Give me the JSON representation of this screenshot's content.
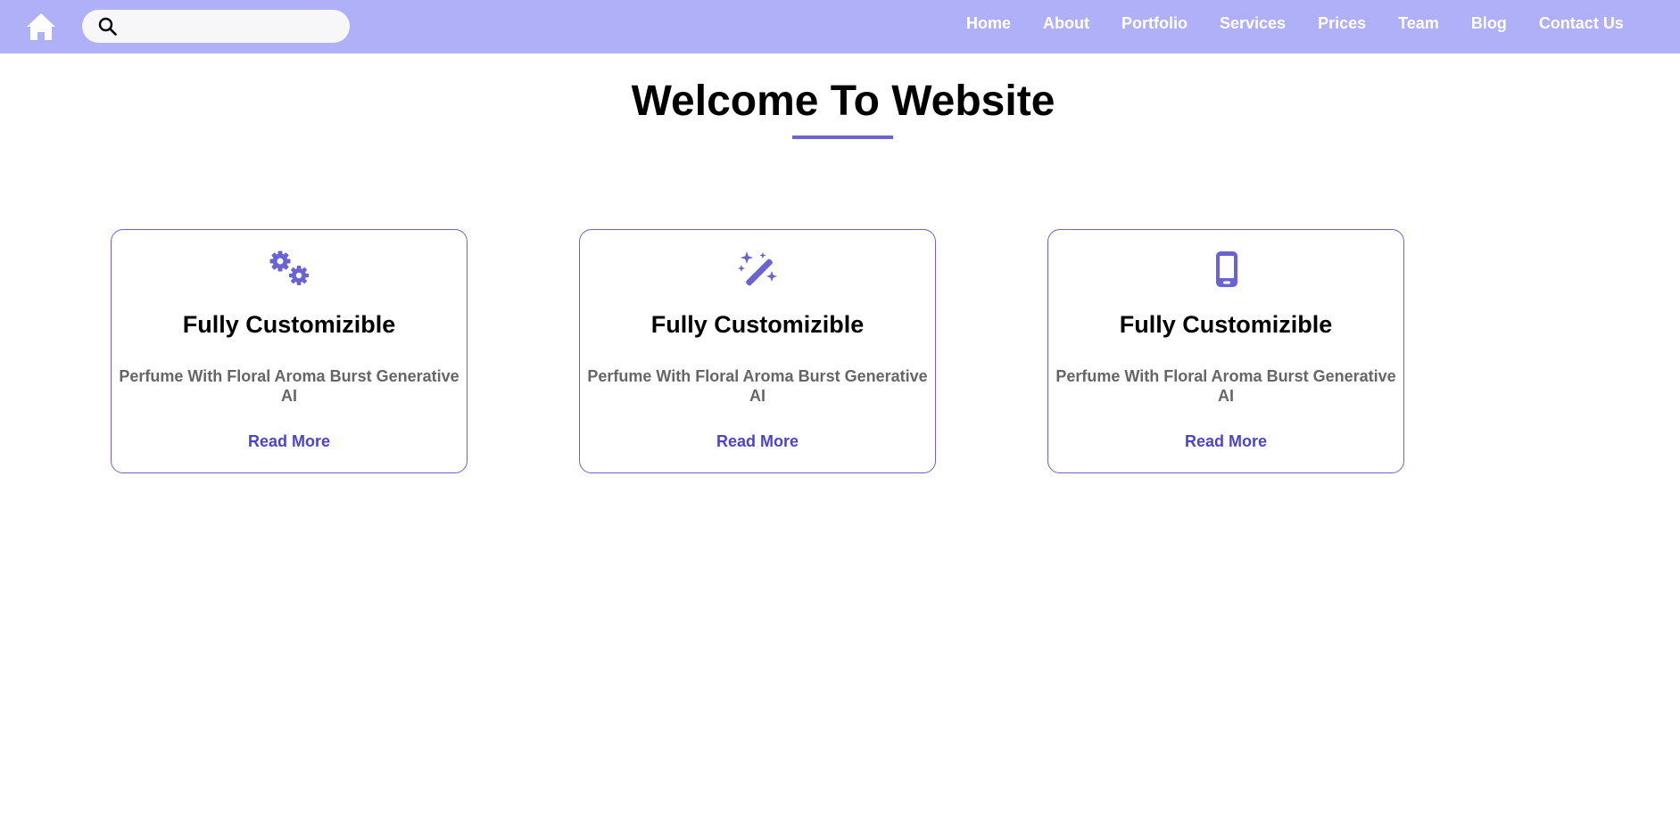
{
  "navbar": {
    "home_icon": "home-icon",
    "search": {
      "icon": "search-icon",
      "placeholder": "",
      "value": ""
    },
    "links": [
      "Home",
      "About",
      "Portfolio",
      "Services",
      "Prices",
      "Team",
      "Blog",
      "Contact Us"
    ]
  },
  "hero": {
    "title": "Welcome To Website"
  },
  "cards": [
    {
      "icon": "gears-icon",
      "title": "Fully Customizible",
      "description": "Perfume With Floral Aroma Burst Generative AI",
      "link": "Read More"
    },
    {
      "icon": "magic-wand-icon",
      "title": "Fully Customizible",
      "description": "Perfume With Floral Aroma Burst Generative AI",
      "link": "Read More"
    },
    {
      "icon": "mobile-phone-icon",
      "title": "Fully Customizible",
      "description": "Perfume With Floral Aroma Burst Generative AI",
      "link": "Read More"
    }
  ],
  "colors": {
    "navbar_bg": "#b0b0f8",
    "accent": "#6b63d3",
    "link": "#4b44cc",
    "body_text": "#666666"
  }
}
